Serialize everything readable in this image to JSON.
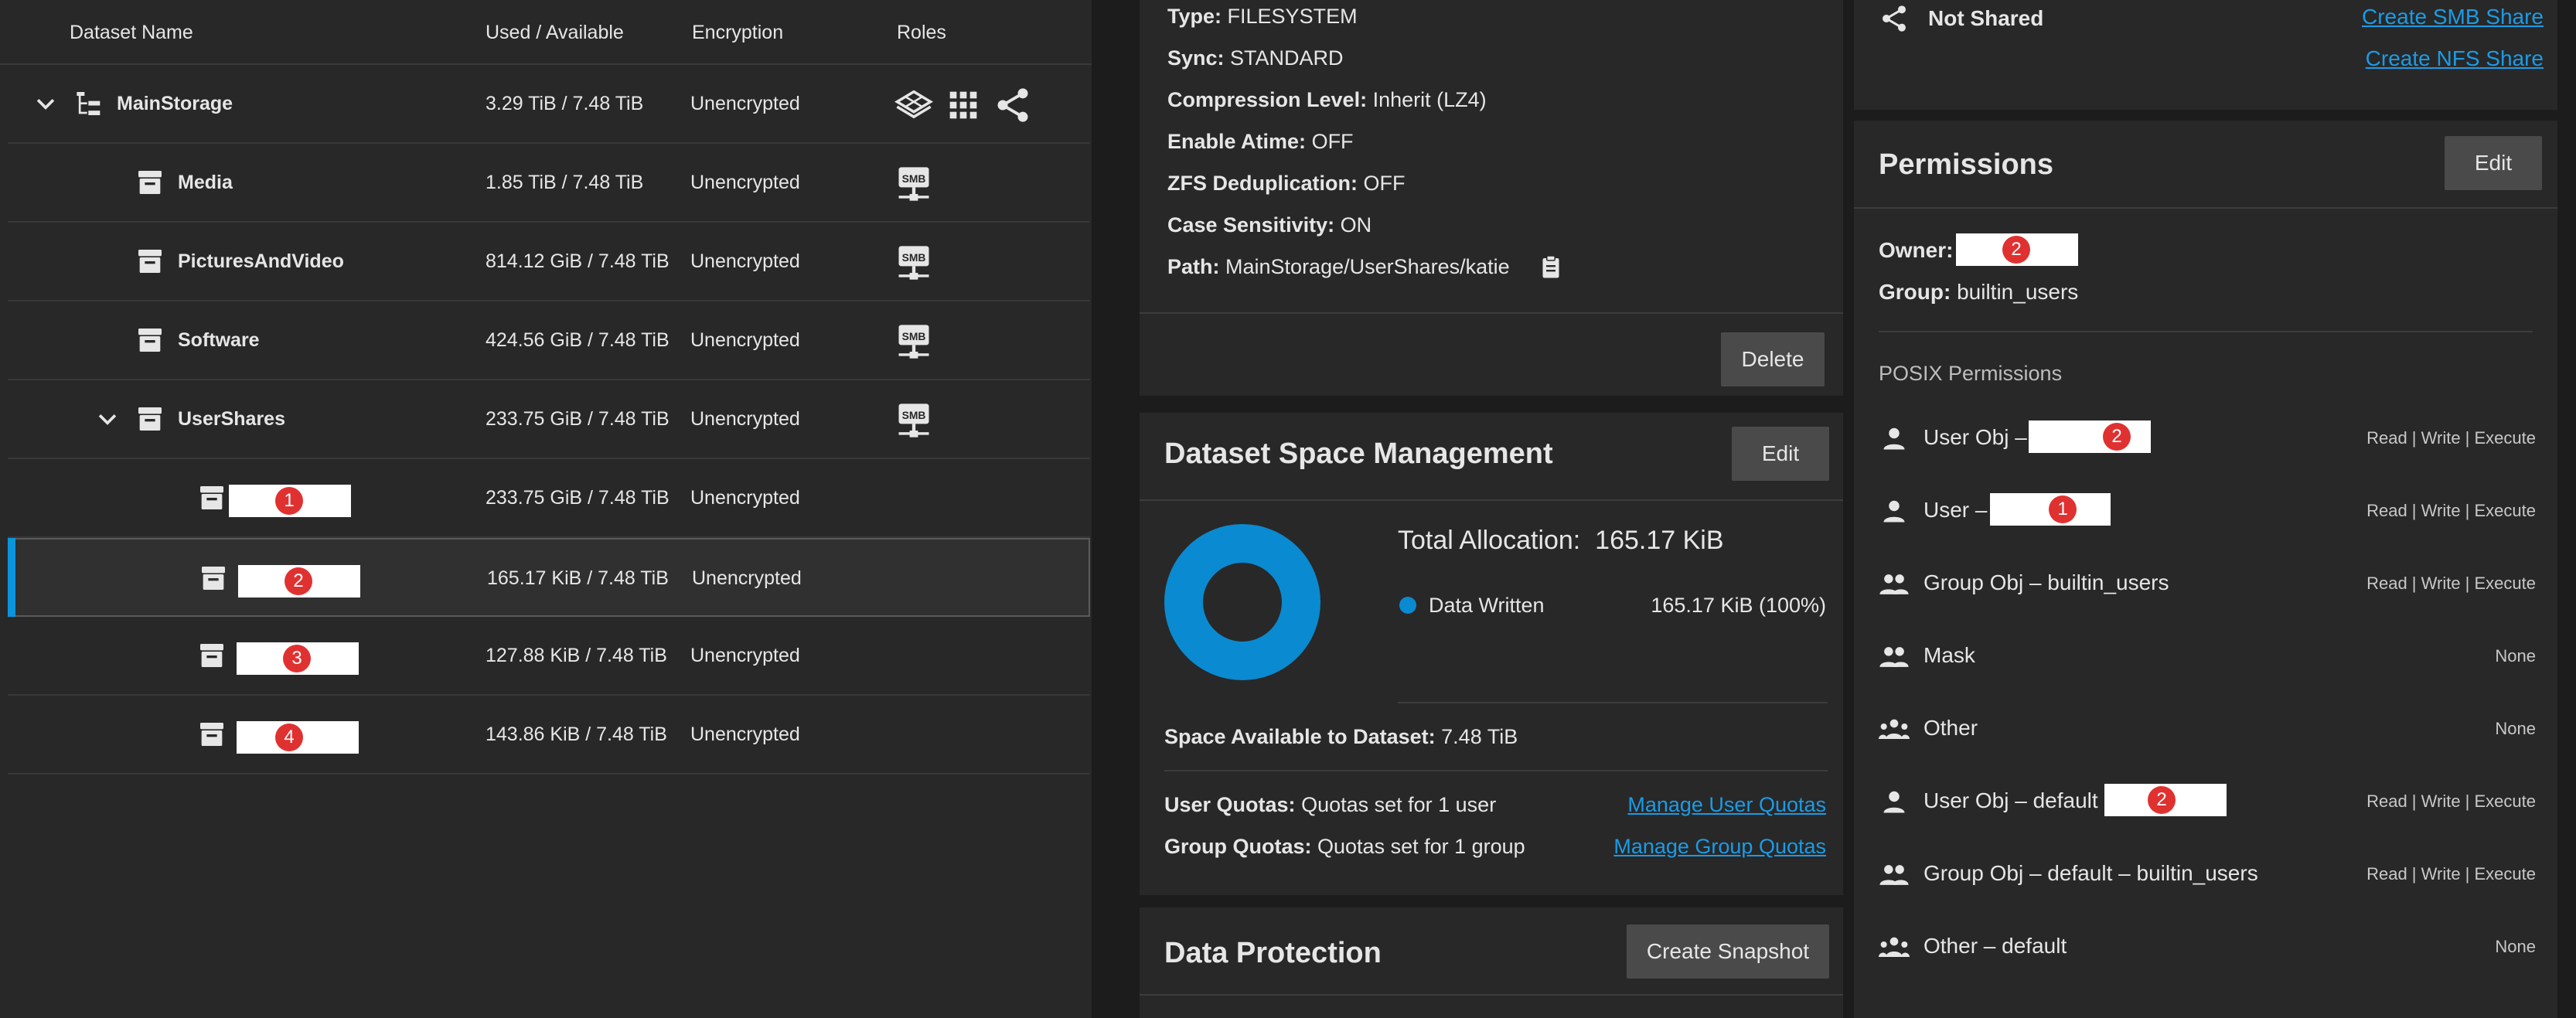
{
  "tree": {
    "columns": [
      "Dataset Name",
      "Used / Available",
      "Encryption",
      "Roles"
    ],
    "rows": [
      {
        "name": "MainStorage",
        "used": "3.29 TiB / 7.48 TiB",
        "enc": "Unencrypted",
        "roles": [
          "storage-pool-icon",
          "apps-grid-icon",
          "share-icon"
        ]
      },
      {
        "name": "Media",
        "used": "1.85 TiB / 7.48 TiB",
        "enc": "Unencrypted",
        "roles": [
          "smb-share-icon"
        ]
      },
      {
        "name": "PicturesAndVideo",
        "used": "814.12 GiB / 7.48 TiB",
        "enc": "Unencrypted",
        "roles": [
          "smb-share-icon"
        ]
      },
      {
        "name": "Software",
        "used": "424.56 GiB / 7.48 TiB",
        "enc": "Unencrypted",
        "roles": [
          "smb-share-icon"
        ]
      },
      {
        "name": "UserShares",
        "used": "233.75 GiB / 7.48 TiB",
        "enc": "Unencrypted",
        "roles": [
          "smb-share-icon"
        ]
      },
      {
        "name": "",
        "badge": "1",
        "used": "233.75 GiB / 7.48 TiB",
        "enc": "Unencrypted"
      },
      {
        "name": "",
        "badge": "2",
        "used": "165.17 KiB / 7.48 TiB",
        "enc": "Unencrypted"
      },
      {
        "name": "",
        "badge": "3",
        "used": "127.88 KiB / 7.48 TiB",
        "enc": "Unencrypted"
      },
      {
        "name": "",
        "badge": "4",
        "used": "143.86 KiB / 7.48 TiB",
        "enc": "Unencrypted"
      }
    ]
  },
  "details": {
    "type_label": "Type:",
    "type_value": "FILESYSTEM",
    "sync_label": "Sync:",
    "sync_value": "STANDARD",
    "compression_label": "Compression Level:",
    "compression_value": "Inherit (LZ4)",
    "atime_label": "Enable Atime:",
    "atime_value": "OFF",
    "dedup_label": "ZFS Deduplication:",
    "dedup_value": "OFF",
    "case_label": "Case Sensitivity:",
    "case_value": "ON",
    "path_label": "Path:",
    "path_value": "MainStorage/UserShares/katie",
    "delete_label": "Delete"
  },
  "space": {
    "title": "Dataset Space Management",
    "edit_label": "Edit",
    "total_label": "Total Allocation:",
    "total_value": "165.17 KiB",
    "legend_label": "Data Written",
    "legend_value": "165.17 KiB (100%)",
    "available_label": "Space Available to Dataset:",
    "available_value": "7.48 TiB",
    "user_quotas_label": "User Quotas:",
    "user_quotas_value": "Quotas set for 1 user",
    "manage_user_quotas": "Manage User Quotas",
    "group_quotas_label": "Group Quotas:",
    "group_quotas_value": "Quotas set for 1 group",
    "manage_group_quotas": "Manage Group Quotas",
    "donut_color": "#0a8ad0",
    "donut_fraction": 1.0
  },
  "protection": {
    "title": "Data Protection",
    "snapshot_label": "Create Snapshot"
  },
  "sharing": {
    "not_shared": "Not Shared",
    "create_smb": "Create SMB Share",
    "create_nfs": "Create NFS Share"
  },
  "permissions": {
    "title": "Permissions",
    "edit_label": "Edit",
    "owner_label": "Owner:",
    "owner_badge": "2",
    "group_label": "Group:",
    "group_value": "builtin_users",
    "posix_label": "POSIX Permissions",
    "entries": [
      {
        "text": "User Obj –",
        "badge": "2",
        "value": "Read | Write | Execute",
        "icon": "person-icon"
      },
      {
        "text": "User –",
        "badge": "1",
        "value": "Read | Write | Execute",
        "icon": "person-icon"
      },
      {
        "text": "Group Obj – builtin_users",
        "value": "Read | Write | Execute",
        "icon": "group-icon"
      },
      {
        "text": "Mask",
        "value": "None",
        "icon": "group-icon"
      },
      {
        "text": "Other",
        "value": "None",
        "icon": "groups-icon"
      },
      {
        "text": "User Obj – default",
        "badge": "2",
        "value": "Read | Write | Execute",
        "icon": "person-icon"
      },
      {
        "text": "Group Obj – default – builtin_users",
        "value": "Read | Write | Execute",
        "icon": "group-icon"
      },
      {
        "text": "Other – default",
        "value": "None",
        "icon": "groups-icon"
      }
    ]
  }
}
